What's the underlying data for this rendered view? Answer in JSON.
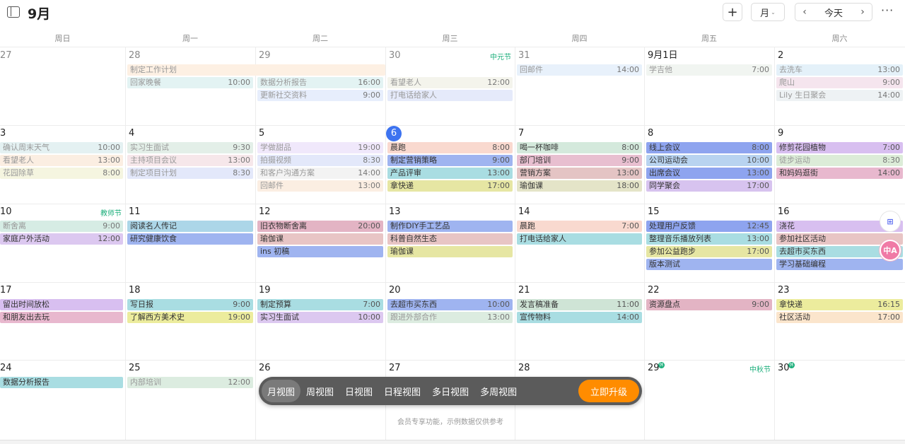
{
  "header": {
    "title": "9月",
    "add": "+",
    "view_label": "月",
    "view_chevron": "⌄",
    "prev": "‹",
    "today": "今天",
    "next": "›",
    "more": "···"
  },
  "weekdays": [
    "周日",
    "周一",
    "周二",
    "周三",
    "周四",
    "周五",
    "周六"
  ],
  "cells": [
    {
      "date": "27",
      "muted": true,
      "events": []
    },
    {
      "date": "28",
      "muted": true,
      "events": [
        {
          "text": "制定工作计划",
          "time": "",
          "color": "#fdf0e3",
          "span": 2
        },
        {
          "text": "回家晚餐",
          "time": "10:00",
          "color": "#e3f3f3"
        }
      ]
    },
    {
      "date": "29",
      "muted": true,
      "events": [
        {
          "text": "",
          "time": "",
          "color": "#fdf0e3",
          "gap": true
        },
        {
          "text": "数据分析报告",
          "time": "16:00",
          "color": "#e3f3f3"
        },
        {
          "text": "更新社交资料",
          "time": "9:00",
          "color": "#e7eefc"
        }
      ]
    },
    {
      "date": "30",
      "muted": true,
      "holiday": "中元节",
      "events": [
        {
          "text": "",
          "time": "",
          "color": "#fff",
          "gap": true
        },
        {
          "text": "看望老人",
          "time": "12:00",
          "color": "#f4f4ec"
        },
        {
          "text": "打电话给家人",
          "time": "",
          "color": "#e5eafa"
        }
      ]
    },
    {
      "date": "31",
      "muted": true,
      "events": [
        {
          "text": "回邮件",
          "time": "14:00",
          "color": "#e8f1fb"
        }
      ]
    },
    {
      "date": "9月1日",
      "events": [
        {
          "text": "学吉他",
          "time": "7:00",
          "color": "#f1f5f1"
        }
      ]
    },
    {
      "date": "2",
      "events": [
        {
          "text": "去洗车",
          "time": "13:00",
          "color": "#e4f1f9"
        },
        {
          "text": "爬山",
          "time": "9:00",
          "color": "#f5e5ee"
        },
        {
          "text": "Lily 生日聚会",
          "time": "14:00",
          "color": "#eef2f4"
        }
      ]
    },
    {
      "date": "3",
      "events": [
        {
          "text": "确认周末天气",
          "time": "10:00",
          "color": "#e4f1f2"
        },
        {
          "text": "看望老人",
          "time": "13:00",
          "color": "#fbeee2"
        },
        {
          "text": "花园除草",
          "time": "8:00",
          "color": "#f5f5e0"
        }
      ]
    },
    {
      "date": "4",
      "events": [
        {
          "text": "实习生面试",
          "time": "9:30",
          "color": "#e3efe8"
        },
        {
          "text": "主持项目会议",
          "time": "13:00",
          "color": "#f6e7ea"
        },
        {
          "text": "制定项目计划",
          "time": "8:30",
          "color": "#e3e8fa"
        }
      ]
    },
    {
      "date": "5",
      "events": [
        {
          "text": "学做甜品",
          "time": "19:00",
          "color": "#f0e8fb"
        },
        {
          "text": "拍摄视频",
          "time": "8:30",
          "color": "#e3e8fa"
        },
        {
          "text": "和客户沟通方案",
          "time": "14:00",
          "color": "#f3f3f3"
        },
        {
          "text": "回邮件",
          "time": "13:00",
          "color": "#fbeee2"
        }
      ]
    },
    {
      "date": "6",
      "today": true,
      "events": [
        {
          "text": "晨跑",
          "time": "8:00",
          "color": "#f9d9cf"
        },
        {
          "text": "制定营销策略",
          "time": "9:00",
          "color": "#9fb4f0"
        },
        {
          "text": "产品评审",
          "time": "13:00",
          "color": "#a9dde2"
        },
        {
          "text": "拿快递",
          "time": "17:00",
          "color": "#e6e6a3"
        }
      ]
    },
    {
      "date": "7",
      "events": [
        {
          "text": "喝一杯咖啡",
          "time": "8:00",
          "color": "#d4e9dc"
        },
        {
          "text": "部门培训",
          "time": "9:00",
          "color": "#e8bfd0"
        },
        {
          "text": "营销方案",
          "time": "13:00",
          "color": "#e4c4c4"
        },
        {
          "text": "瑜伽课",
          "time": "18:00",
          "color": "#e4e4c8"
        }
      ]
    },
    {
      "date": "8",
      "events": [
        {
          "text": "线上会议",
          "time": "8:00",
          "color": "#8ea4ef"
        },
        {
          "text": "公司运动会",
          "time": "10:00",
          "color": "#b8d3f0"
        },
        {
          "text": "出席会议",
          "time": "13:00",
          "color": "#8ea4ef"
        },
        {
          "text": "同学聚会",
          "time": "17:00",
          "color": "#d7c3ef"
        }
      ]
    },
    {
      "date": "9",
      "events": [
        {
          "text": "修剪花园植物",
          "time": "7:00",
          "color": "#d8bff0"
        },
        {
          "text": "徒步运动",
          "time": "8:30",
          "color": "#dcecd8"
        },
        {
          "text": "和妈妈逛街",
          "time": "14:00",
          "color": "#e8b8ce"
        }
      ]
    },
    {
      "date": "10",
      "holiday": "教师节",
      "events": [
        {
          "text": "断舍离",
          "time": "9:00",
          "color": "#d6ece4"
        },
        {
          "text": "家庭户外活动",
          "time": "12:00",
          "color": "#dcc8f0"
        }
      ]
    },
    {
      "date": "11",
      "events": [
        {
          "text": "阅读名人传记",
          "time": "",
          "color": "#acd6e8"
        },
        {
          "text": "研究健康饮食",
          "time": "",
          "color": "#9fb4f0"
        }
      ]
    },
    {
      "date": "12",
      "events": [
        {
          "text": "旧衣物断舍离",
          "time": "20:00",
          "color": "#e3b4c4"
        },
        {
          "text": "瑜伽课",
          "time": "",
          "color": "#e8c5c5"
        },
        {
          "text": "ins 初稿",
          "time": "",
          "color": "#9fb4f0"
        }
      ]
    },
    {
      "date": "13",
      "events": [
        {
          "text": "制作DIY手工艺品",
          "time": "",
          "color": "#9fb4f0"
        },
        {
          "text": "科普自然生态",
          "time": "",
          "color": "#e8c5c5"
        },
        {
          "text": "瑜伽课",
          "time": "",
          "color": "#e6e6a3"
        }
      ]
    },
    {
      "date": "14",
      "events": [
        {
          "text": "晨跑",
          "time": "7:00",
          "color": "#f9d9cf"
        },
        {
          "text": "打电话给家人",
          "time": "",
          "color": "#a9dde2"
        }
      ]
    },
    {
      "date": "15",
      "events": [
        {
          "text": "处理用户反馈",
          "time": "12:45",
          "color": "#8ea4ef"
        },
        {
          "text": "整理音乐播放列表",
          "time": "13:00",
          "color": "#a9dde2"
        },
        {
          "text": "参加公益跑步",
          "time": "17:00",
          "color": "#e6e6a3"
        },
        {
          "text": "版本测试",
          "time": "",
          "color": "#9fb4f0"
        }
      ]
    },
    {
      "date": "16",
      "events": [
        {
          "text": "浇花",
          "time": "",
          "color": "#d8bff0"
        },
        {
          "text": "参加社区活动",
          "time": "",
          "color": "#e8c5c5"
        },
        {
          "text": "去超市买东西",
          "time": "",
          "color": "#a9dde2"
        },
        {
          "text": "学习基础编程",
          "time": "",
          "color": "#9fb4f0"
        }
      ]
    },
    {
      "date": "17",
      "events": [
        {
          "text": "留出时间放松",
          "time": "",
          "color": "#d8bff0"
        },
        {
          "text": "和朋友出去玩",
          "time": "",
          "color": "#e8b8ce"
        }
      ]
    },
    {
      "date": "18",
      "events": [
        {
          "text": "写日报",
          "time": "9:00",
          "color": "#a9dde2"
        },
        {
          "text": "了解西方美术史",
          "time": "19:00",
          "color": "#ecec9d"
        }
      ]
    },
    {
      "date": "19",
      "events": [
        {
          "text": "制定预算",
          "time": "7:00",
          "color": "#a9dde2"
        },
        {
          "text": "实习生面试",
          "time": "10:00",
          "color": "#dcc8f0"
        }
      ]
    },
    {
      "date": "20",
      "events": [
        {
          "text": "去超市买东西",
          "time": "10:00",
          "color": "#9fb4f0"
        },
        {
          "text": "跟进外部合作",
          "time": "13:00",
          "color": "#dcece0"
        }
      ]
    },
    {
      "date": "21",
      "events": [
        {
          "text": "发言稿准备",
          "time": "11:00",
          "color": "#cfe4d6"
        },
        {
          "text": "宣传物料",
          "time": "14:00",
          "color": "#a9dde2"
        }
      ]
    },
    {
      "date": "22",
      "events": [
        {
          "text": "资源盘点",
          "time": "9:00",
          "color": "#e3b4c4"
        }
      ]
    },
    {
      "date": "23",
      "events": [
        {
          "text": "拿快递",
          "time": "16:15",
          "color": "#ecec9d"
        },
        {
          "text": "社区活动",
          "time": "17:00",
          "color": "#fbe5cc"
        }
      ]
    },
    {
      "date": "24",
      "events": [
        {
          "text": "数据分析报告",
          "time": "",
          "color": "#a9dde2"
        }
      ]
    },
    {
      "date": "25",
      "events": [
        {
          "text": "内部培训",
          "time": "12:00",
          "color": "#dcece0"
        }
      ]
    },
    {
      "date": "26",
      "events": []
    },
    {
      "date": "27",
      "events": []
    },
    {
      "date": "28",
      "events": []
    },
    {
      "date": "29",
      "holiday": "中秋节",
      "badge": "休",
      "events": []
    },
    {
      "date": "30",
      "badge": "休",
      "events": []
    }
  ],
  "toolbar": {
    "items": [
      "月视图",
      "周视图",
      "日视图",
      "日程视图",
      "多日视图",
      "多周视图"
    ],
    "upgrade": "立即升级",
    "note": "会员专享功能，示例数据仅供参考"
  },
  "float": {
    "a": "⊞",
    "b": "中A"
  }
}
